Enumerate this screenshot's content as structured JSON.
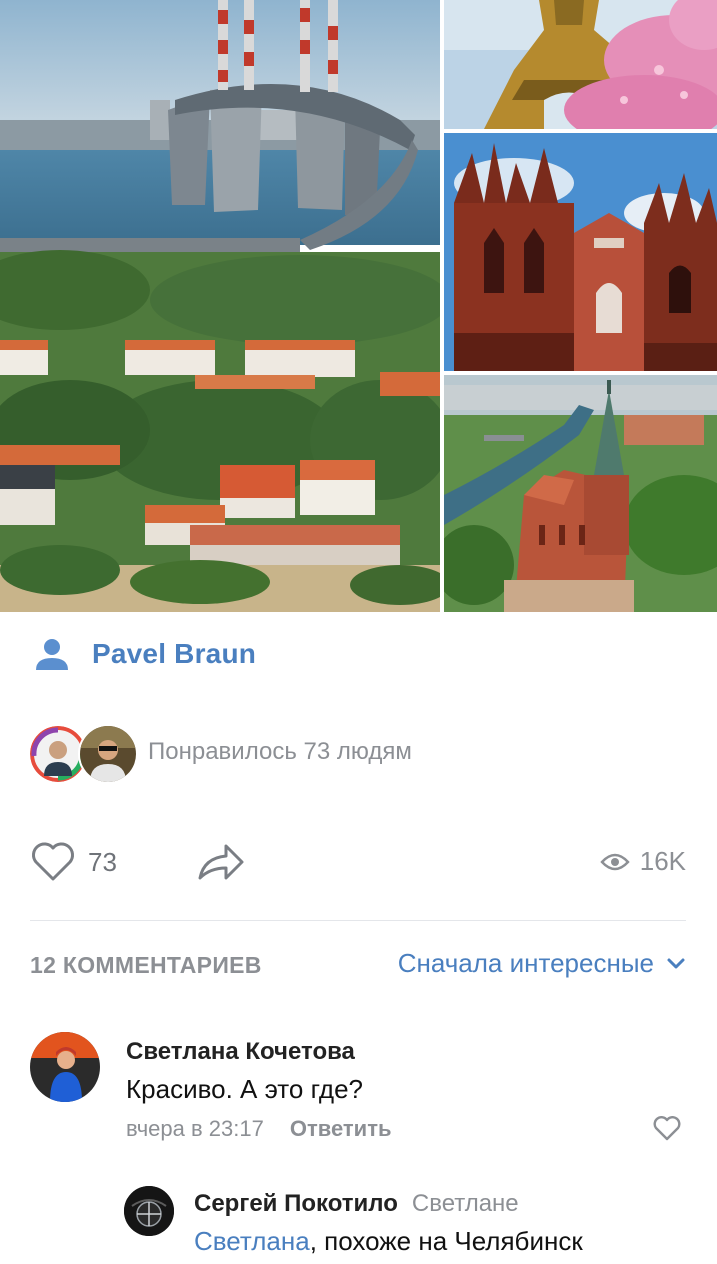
{
  "post": {
    "photos": [
      {
        "name": "bridge-town-photo"
      },
      {
        "name": "eiffel-tower-photo"
      },
      {
        "name": "gothic-church-photo"
      },
      {
        "name": "cathedral-aerial-photo"
      }
    ],
    "author": {
      "name": "Pavel Braun",
      "icon": "user-icon"
    },
    "likes_summary": {
      "text": "Понравилось 73 людям"
    },
    "actions": {
      "like_count": "73",
      "like_icon": "heart-icon",
      "share_icon": "share-arrow-icon",
      "views_icon": "eye-icon",
      "views_count": "16K"
    }
  },
  "comments": {
    "count_label": "12 КОММЕНТАРИЕВ",
    "sort_label": "Сначала интересные",
    "items": [
      {
        "author": "Светлана Кочетова",
        "text": "Красиво. А это где?",
        "time": "вчера в 23:17",
        "reply_label": "Ответить"
      }
    ],
    "reply": {
      "author": "Сергей Покотило",
      "to": "Светлане",
      "mention": "Светлана",
      "text": ", похоже на Челябинск"
    }
  },
  "colors": {
    "link_blue": "#4a7fbf",
    "muted_gray": "#8c8f94",
    "divider": "#e4e6ea"
  }
}
